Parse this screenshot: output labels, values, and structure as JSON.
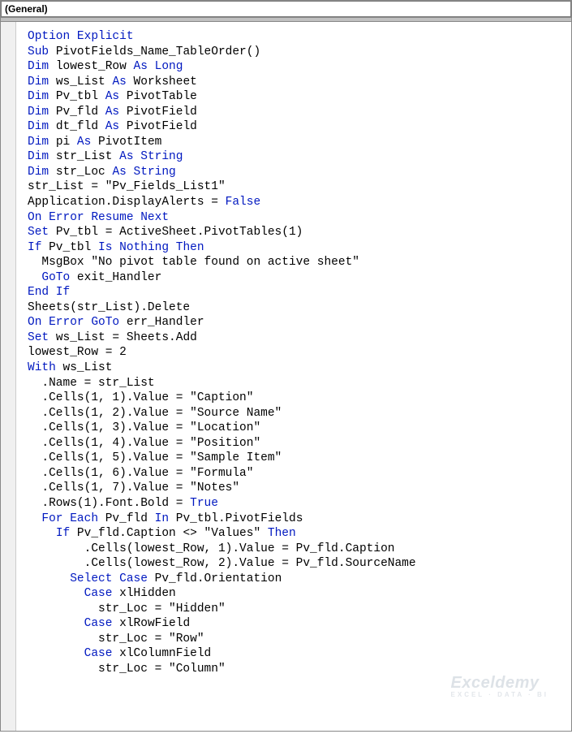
{
  "header": {
    "dropdown_label": "(General)"
  },
  "code": {
    "lines": [
      [
        {
          "t": "Option Explicit",
          "c": "kw"
        }
      ],
      [
        {
          "t": "Sub ",
          "c": "kw"
        },
        {
          "t": "PivotFields_Name_TableOrder()"
        }
      ],
      [
        {
          "t": "Dim ",
          "c": "kw"
        },
        {
          "t": "lowest_Row "
        },
        {
          "t": "As Long",
          "c": "kw"
        }
      ],
      [
        {
          "t": "Dim ",
          "c": "kw"
        },
        {
          "t": "ws_List "
        },
        {
          "t": "As ",
          "c": "kw"
        },
        {
          "t": "Worksheet"
        }
      ],
      [
        {
          "t": "Dim ",
          "c": "kw"
        },
        {
          "t": "Pv_tbl "
        },
        {
          "t": "As ",
          "c": "kw"
        },
        {
          "t": "PivotTable"
        }
      ],
      [
        {
          "t": "Dim ",
          "c": "kw"
        },
        {
          "t": "Pv_fld "
        },
        {
          "t": "As ",
          "c": "kw"
        },
        {
          "t": "PivotField"
        }
      ],
      [
        {
          "t": "Dim ",
          "c": "kw"
        },
        {
          "t": "dt_fld "
        },
        {
          "t": "As ",
          "c": "kw"
        },
        {
          "t": "PivotField"
        }
      ],
      [
        {
          "t": "Dim ",
          "c": "kw"
        },
        {
          "t": "pi "
        },
        {
          "t": "As ",
          "c": "kw"
        },
        {
          "t": "PivotItem"
        }
      ],
      [
        {
          "t": "Dim ",
          "c": "kw"
        },
        {
          "t": "str_List "
        },
        {
          "t": "As String",
          "c": "kw"
        }
      ],
      [
        {
          "t": "Dim ",
          "c": "kw"
        },
        {
          "t": "str_Loc "
        },
        {
          "t": "As String",
          "c": "kw"
        }
      ],
      [
        {
          "t": "str_List = \"Pv_Fields_List1\""
        }
      ],
      [
        {
          "t": "Application.DisplayAlerts = "
        },
        {
          "t": "False",
          "c": "kw"
        }
      ],
      [
        {
          "t": "On Error Resume Next",
          "c": "kw"
        }
      ],
      [
        {
          "t": "Set ",
          "c": "kw"
        },
        {
          "t": "Pv_tbl = ActiveSheet.PivotTables(1)"
        }
      ],
      [
        {
          "t": "If ",
          "c": "kw"
        },
        {
          "t": "Pv_tbl "
        },
        {
          "t": "Is Nothing Then",
          "c": "kw"
        }
      ],
      [
        {
          "t": "  MsgBox \"No pivot table found on active sheet\""
        }
      ],
      [
        {
          "t": "  "
        },
        {
          "t": "GoTo ",
          "c": "kw"
        },
        {
          "t": "exit_Handler"
        }
      ],
      [
        {
          "t": "End If",
          "c": "kw"
        }
      ],
      [
        {
          "t": "Sheets(str_List).Delete"
        }
      ],
      [
        {
          "t": "On Error GoTo ",
          "c": "kw"
        },
        {
          "t": "err_Handler"
        }
      ],
      [
        {
          "t": "Set ",
          "c": "kw"
        },
        {
          "t": "ws_List = Sheets.Add"
        }
      ],
      [
        {
          "t": "lowest_Row = 2"
        }
      ],
      [
        {
          "t": "With ",
          "c": "kw"
        },
        {
          "t": "ws_List"
        }
      ],
      [
        {
          "t": "  .Name = str_List"
        }
      ],
      [
        {
          "t": "  .Cells(1, 1).Value = \"Caption\""
        }
      ],
      [
        {
          "t": "  .Cells(1, 2).Value = \"Source Name\""
        }
      ],
      [
        {
          "t": "  .Cells(1, 3).Value = \"Location\""
        }
      ],
      [
        {
          "t": "  .Cells(1, 4).Value = \"Position\""
        }
      ],
      [
        {
          "t": "  .Cells(1, 5).Value = \"Sample Item\""
        }
      ],
      [
        {
          "t": "  .Cells(1, 6).Value = \"Formula\""
        }
      ],
      [
        {
          "t": "  .Cells(1, 7).Value = \"Notes\""
        }
      ],
      [
        {
          "t": "  .Rows(1).Font.Bold = "
        },
        {
          "t": "True",
          "c": "kw"
        }
      ],
      [
        {
          "t": "  "
        },
        {
          "t": "For Each ",
          "c": "kw"
        },
        {
          "t": "Pv_fld "
        },
        {
          "t": "In ",
          "c": "kw"
        },
        {
          "t": "Pv_tbl.PivotFields"
        }
      ],
      [
        {
          "t": "    "
        },
        {
          "t": "If ",
          "c": "kw"
        },
        {
          "t": "Pv_fld.Caption <> \"Values\" "
        },
        {
          "t": "Then",
          "c": "kw"
        }
      ],
      [
        {
          "t": "        .Cells(lowest_Row, 1).Value = Pv_fld.Caption"
        }
      ],
      [
        {
          "t": "        .Cells(lowest_Row, 2).Value = Pv_fld.SourceName"
        }
      ],
      [
        {
          "t": "      "
        },
        {
          "t": "Select Case ",
          "c": "kw"
        },
        {
          "t": "Pv_fld.Orientation"
        }
      ],
      [
        {
          "t": "        "
        },
        {
          "t": "Case ",
          "c": "kw"
        },
        {
          "t": "xlHidden"
        }
      ],
      [
        {
          "t": "          str_Loc = \"Hidden\""
        }
      ],
      [
        {
          "t": "        "
        },
        {
          "t": "Case ",
          "c": "kw"
        },
        {
          "t": "xlRowField"
        }
      ],
      [
        {
          "t": "          str_Loc = \"Row\""
        }
      ],
      [
        {
          "t": "        "
        },
        {
          "t": "Case ",
          "c": "kw"
        },
        {
          "t": "xlColumnField"
        }
      ],
      [
        {
          "t": "          str_Loc = \"Column\""
        }
      ]
    ]
  },
  "watermark": {
    "main": "Exceldemy",
    "sub": "EXCEL · DATA · BI"
  }
}
